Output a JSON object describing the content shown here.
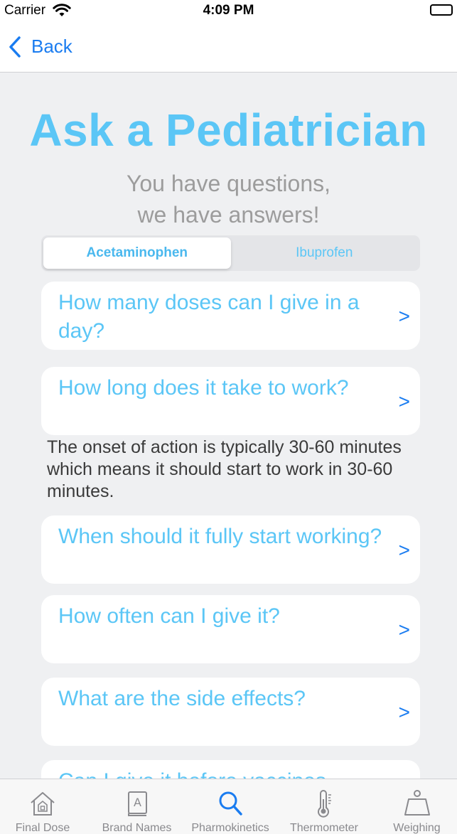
{
  "status_bar": {
    "carrier": "Carrier",
    "time": "4:09 PM"
  },
  "nav": {
    "back_label": "Back"
  },
  "header": {
    "title": "Ask a Pediatrician",
    "subtitle_line1": "You have questions,",
    "subtitle_line2": "we have answers!"
  },
  "segments": [
    {
      "label": "Acetaminophen",
      "selected": true
    },
    {
      "label": "Ibuprofen",
      "selected": false
    }
  ],
  "questions": [
    {
      "text": "How many doses can I give in a day?",
      "chevron": ">"
    },
    {
      "text": "How long does it take to work?",
      "chevron": ">"
    },
    {
      "text": "When should it fully start working?",
      "chevron": ">"
    },
    {
      "text": "How often can I give it?",
      "chevron": ">"
    },
    {
      "text": "What are the side effects?",
      "chevron": ">"
    },
    {
      "text": "Can I give it before vaccines",
      "chevron": ">"
    }
  ],
  "answer": {
    "text": "The onset of action is typically 30-60 minutes which means it should start to work in 30-60 minutes."
  },
  "tabs": [
    {
      "label": "Final Dose",
      "icon": "home-icon",
      "active": false
    },
    {
      "label": "Brand Names",
      "icon": "book-icon",
      "active": false
    },
    {
      "label": "Pharmokinetics",
      "icon": "search-icon",
      "active": true
    },
    {
      "label": "Thermometer",
      "icon": "thermometer-icon",
      "active": false
    },
    {
      "label": "Weighing",
      "icon": "scale-icon",
      "active": false
    }
  ],
  "colors": {
    "accent": "#1a7cf0",
    "title_blue": "#5bc6f6",
    "background": "#eff0f2"
  }
}
